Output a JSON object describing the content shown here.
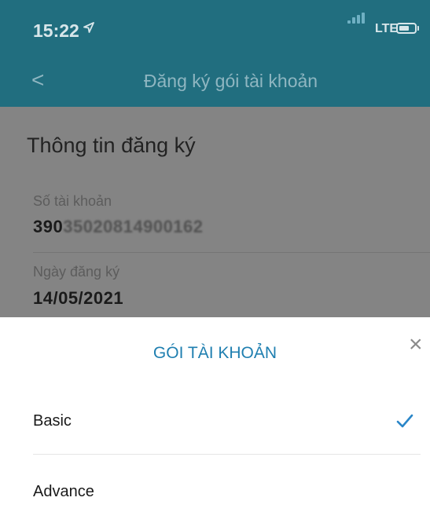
{
  "status_bar": {
    "time": "15:22",
    "network": "LTE"
  },
  "nav": {
    "back": "<",
    "title": "Đăng ký gói tài khoản"
  },
  "info": {
    "section_title": "Thông tin đăng ký",
    "account_label": "Số tài khoản",
    "account_prefix": "390",
    "account_masked": "35020814900162",
    "date_label": "Ngày đăng ký",
    "date_value": "14/05/2021"
  },
  "sheet": {
    "title": "GÓI TÀI KHOẢN",
    "close": "×",
    "options": [
      {
        "label": "Basic",
        "selected": true
      },
      {
        "label": "Advance",
        "selected": false
      }
    ]
  },
  "colors": {
    "header": "#216e7f",
    "accent": "#1f7fb0",
    "check": "#2a86c8"
  }
}
